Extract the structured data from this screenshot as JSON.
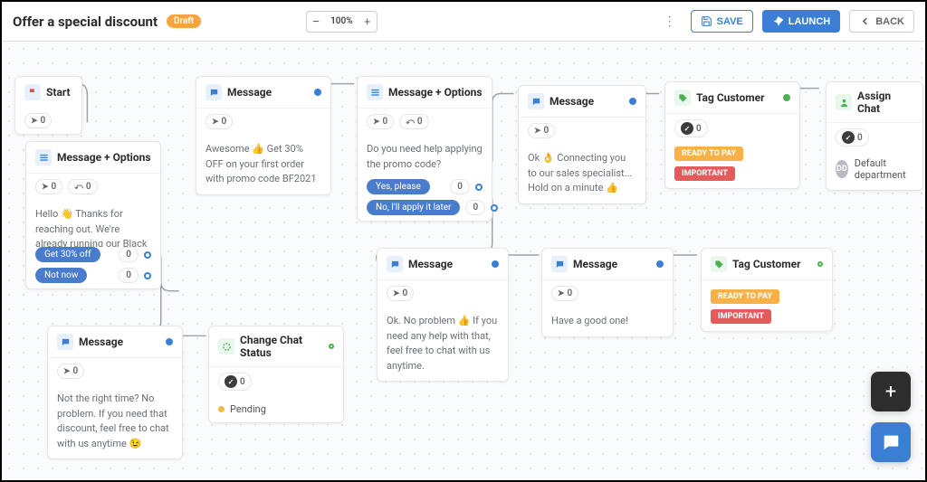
{
  "header": {
    "title": "Offer a special discount",
    "status_badge": "Draft",
    "zoom": "100%",
    "save": "SAVE",
    "launch": "LAUNCH",
    "back": "BACK"
  },
  "nodes": {
    "start": {
      "label": "Start",
      "count": "0"
    },
    "msg_opts_1": {
      "label": "Message + Options",
      "sent": "0",
      "replies": "0",
      "body": "Hello 👋 Thanks for reaching out. We're already running our Black Friday deal! 🔥 You can get 30% OFF your first payment. Are you in? 😎",
      "opt1": "Get 30% off",
      "opt1_count": "0",
      "opt2": "Not now",
      "opt2_count": "0"
    },
    "msg_1": {
      "label": "Message",
      "sent": "0",
      "body": "Awesome 👍 Get 30% OFF on your first order with promo code BF2021"
    },
    "msg_opts_2": {
      "label": "Message + Options",
      "sent": "0",
      "replies": "0",
      "body": "Do you need help applying the promo code?",
      "opt1": "Yes, please",
      "opt1_count": "0",
      "opt2": "No, I'll apply it later",
      "opt2_count": "0"
    },
    "msg_2": {
      "label": "Message",
      "sent": "0",
      "body": "Ok 👌 Connecting you to our sales specialist... Hold on a minute 👍"
    },
    "tag_1": {
      "label": "Tag Customer",
      "count": "0",
      "tag1": "READY TO PAY",
      "tag2": "IMPORTANT"
    },
    "assign": {
      "label": "Assign Chat",
      "count": "0",
      "dept_initials": "DD",
      "dept": "Default department"
    },
    "msg_3": {
      "label": "Message",
      "sent": "0",
      "body": "Not the right time? No problem. If you need that discount, feel free to chat with us anytime 😉"
    },
    "change_status": {
      "label": "Change Chat Status",
      "count": "0",
      "status": "Pending"
    },
    "msg_4": {
      "label": "Message",
      "sent": "0",
      "body": "Ok. No problem 👍 If you need any help with that, feel free to chat with us anytime."
    },
    "msg_5": {
      "label": "Message",
      "sent": "0",
      "body": "Have a good one!"
    },
    "tag_2": {
      "label": "Tag Customer",
      "tag1": "READY TO PAY",
      "tag2": "IMPORTANT"
    }
  }
}
